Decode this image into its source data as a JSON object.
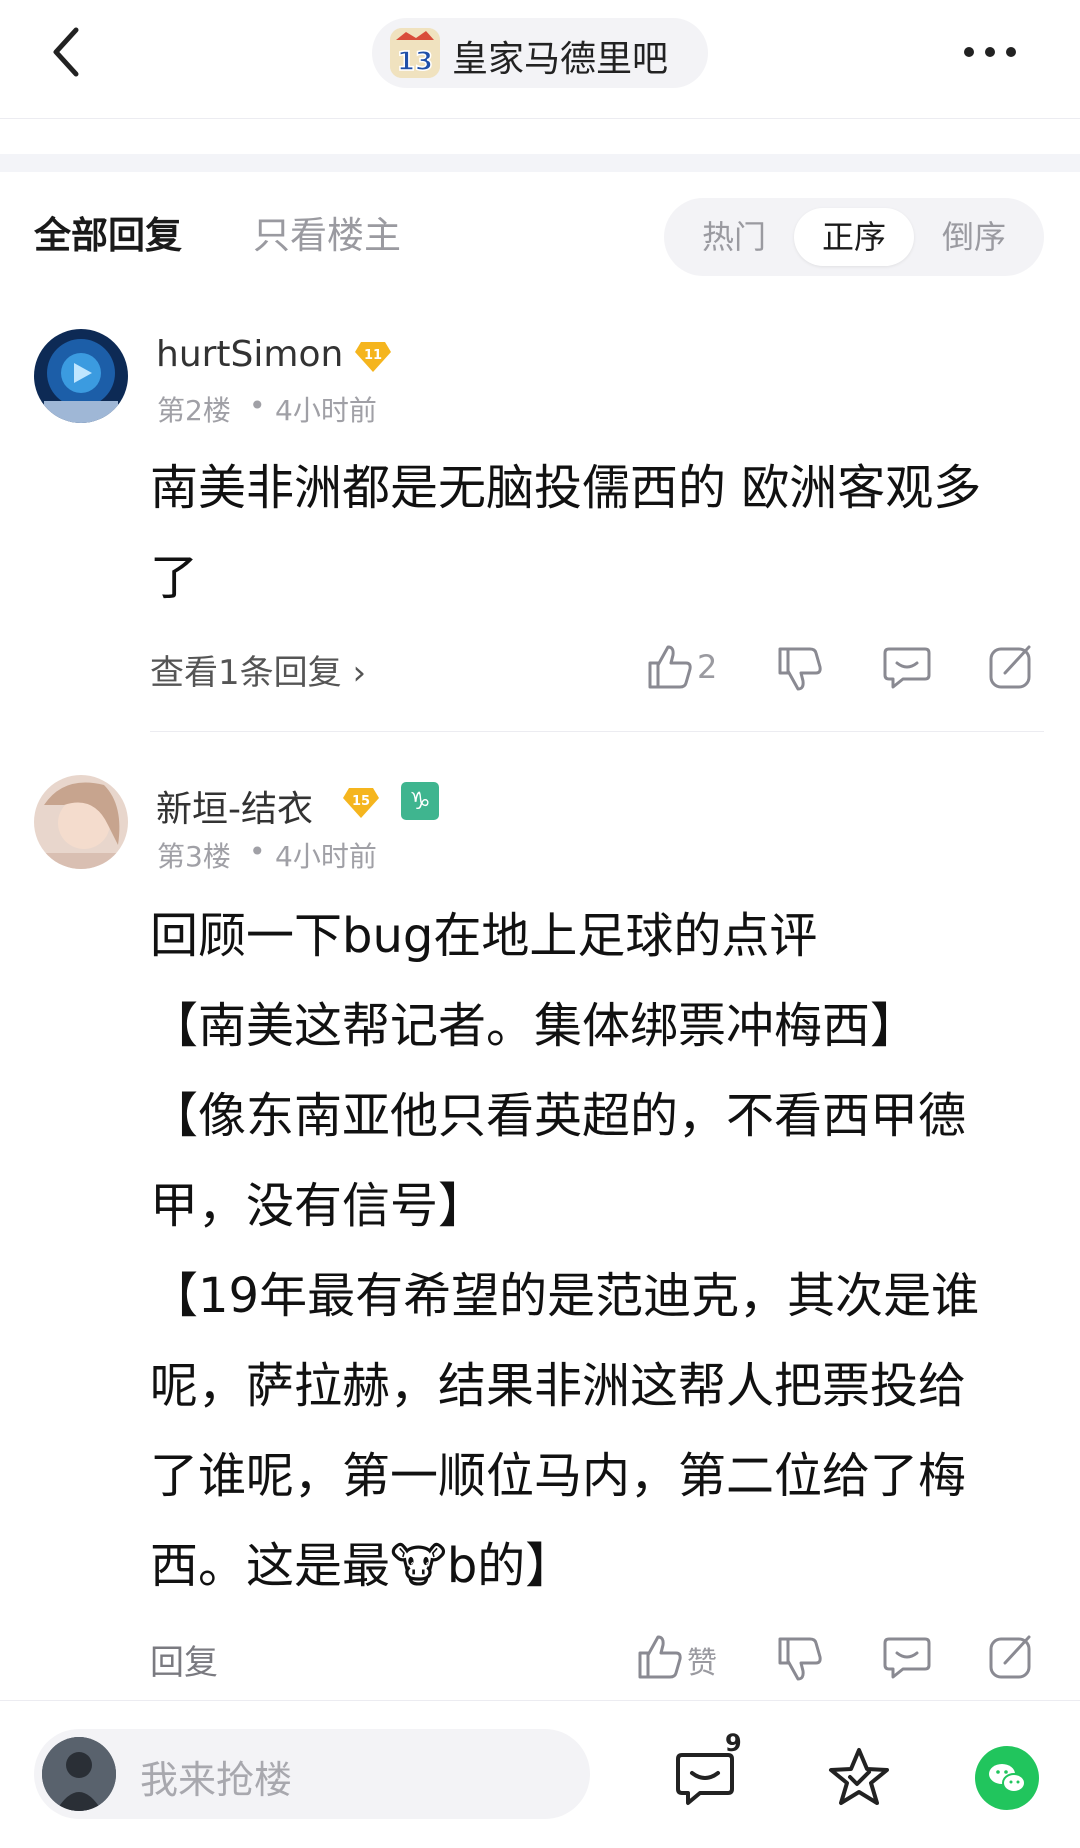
{
  "header": {
    "forum_name": "皇家马德里吧",
    "forum_logo_text": "13"
  },
  "tabs": {
    "all": "全部回复",
    "op_only": "只看楼主"
  },
  "sort": {
    "options": [
      "热门",
      "正序",
      "倒序"
    ],
    "selected": "正序"
  },
  "posts": [
    {
      "username": "hurtSimon",
      "level": "11",
      "floor": "第2楼",
      "time": "4小时前",
      "lines": [
        "南美非洲都是无脑投儒西的 欧洲客观多",
        "了"
      ],
      "reply_link": "查看1条回复 ›",
      "like_count": "2"
    },
    {
      "username": "新垣-结衣",
      "level": "15",
      "zodiac": "♑",
      "floor": "第3楼",
      "time": "4小时前",
      "lines": [
        "回顾一下bug在地上足球的点评",
        "【南美这帮记者。集体绑票冲梅西】",
        "【像东南亚他只看英超的，不看西甲德",
        "甲，没有信号】",
        "【19年最有希望的是范迪克，其次是谁",
        "呢，萨拉赫，结果非洲这帮人把票投给",
        "了谁呢，第一顺位马内，第二位给了梅"
      ],
      "last_line_before": "西。这是最",
      "last_line_emoji": "🐮",
      "last_line_after": "b的】",
      "reply_link": "回复",
      "like_label": "赞"
    }
  ],
  "dot": "•",
  "bottom": {
    "placeholder": "我来抢楼",
    "comment_count": "9"
  },
  "colors": {
    "accent_gold": "#f5b51e",
    "zodiac_green": "#3fb58f",
    "wechat_green": "#21c55d",
    "muted": "#9a9aa0"
  },
  "icons": [
    "back-icon",
    "more-icon",
    "thumbs-up-icon",
    "thumbs-down-icon",
    "chat-bubble-icon",
    "share-icon",
    "comment-icon",
    "star-icon",
    "wechat-icon"
  ]
}
